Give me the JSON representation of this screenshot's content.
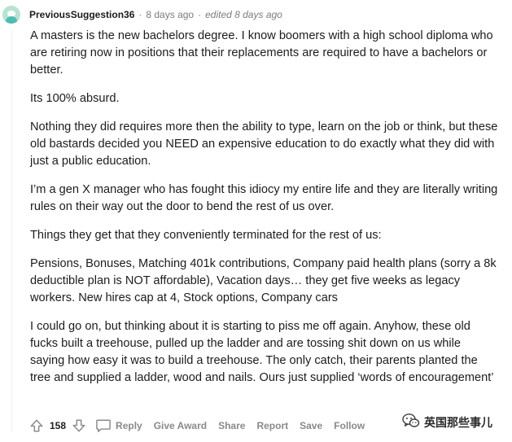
{
  "comment": {
    "author": "PreviousSuggestion36",
    "separator": "·",
    "time": "8 days ago",
    "edited": "edited 8 days ago",
    "paragraphs": [
      "A masters is the new bachelors degree. I know boomers with a high school diploma who are retiring now in positions that their replacements are required to have a bachelors or better.",
      "Its 100% absurd.",
      "Nothing they did requires more then the ability to type, learn on the job or think, but these old bastards decided you NEED an expensive education to do exactly what they did with just a public education.",
      "I’m a gen X manager who has fought this idiocy my entire life and they are literally writing rules on their way out the door to bend the rest of us over.",
      "Things they get that they conveniently terminated for the rest of us:",
      "Pensions, Bonuses, Matching 401k contributions, Company paid health plans (sorry a 8k deductible plan is NOT affordable), Vacation days… they get five weeks as legacy workers. New hires cap at 4, Stock options, Company cars",
      "I could go on, but thinking about it is starting to piss me off again. Anyhow, these old fucks built a treehouse, pulled up the ladder and are tossing shit down on us while saying how easy it was to build a treehouse. The only catch, their parents planted the tree and supplied a ladder, wood and nails. Ours just supplied ‘words of encouragement’"
    ]
  },
  "actions": {
    "vote_count": "158",
    "reply": "Reply",
    "give_award": "Give Award",
    "share": "Share",
    "report": "Report",
    "save": "Save",
    "follow": "Follow"
  },
  "watermark": {
    "text": "英国那些事儿",
    "icon": "wechat-icon"
  },
  "colors": {
    "text": "#1c1c1c",
    "meta": "#7c7c7c",
    "action": "#878a8c",
    "avatar_bg": "#b7e3cf",
    "thread_line": "#edeff1"
  }
}
